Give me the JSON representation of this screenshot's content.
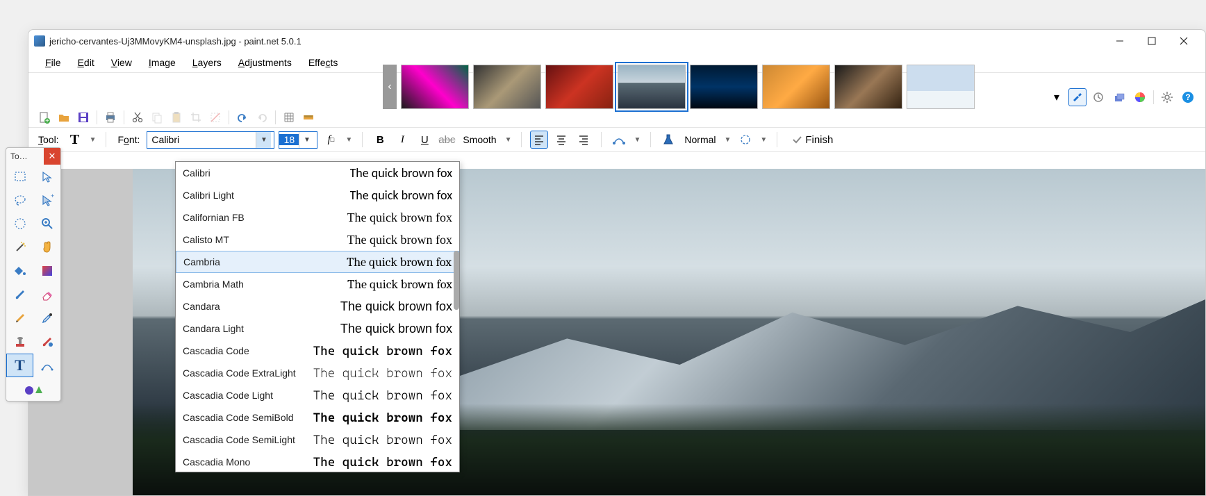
{
  "window": {
    "title": "jericho-cervantes-Uj3MMovyKM4-unsplash.jpg - paint.net 5.0.1"
  },
  "menu": {
    "file": "File",
    "edit": "Edit",
    "view": "View",
    "image": "Image",
    "layers": "Layers",
    "adjustments": "Adjustments",
    "effects": "Effects"
  },
  "toolbar_opts": {
    "tool_label": "Tool:",
    "font_label": "Font:",
    "font_value": "Calibri",
    "size_value": "18",
    "aa_label": "Smooth",
    "blend_label": "Normal",
    "finish_label": "Finish"
  },
  "toolbox": {
    "title": "To…"
  },
  "font_dropdown": {
    "sample": "The quick brown fox",
    "highlighted_index": 4,
    "items": [
      {
        "name": "Calibri",
        "style": "font-family: Calibri, sans-serif;"
      },
      {
        "name": "Calibri Light",
        "style": "font-family: 'Calibri Light', Calibri, sans-serif; font-weight: 300;"
      },
      {
        "name": "Californian FB",
        "style": "font-family: 'Californian FB', serif;"
      },
      {
        "name": "Calisto MT",
        "style": "font-family: 'Calisto MT', serif;"
      },
      {
        "name": "Cambria",
        "style": "font-family: Cambria, serif;"
      },
      {
        "name": "Cambria Math",
        "style": "font-family: 'Cambria Math', Cambria, serif;"
      },
      {
        "name": "Candara",
        "style": "font-family: Candara, sans-serif;"
      },
      {
        "name": "Candara Light",
        "style": "font-family: 'Candara Light', Candara, sans-serif; font-weight: 300;"
      },
      {
        "name": "Cascadia Code",
        "style": "font-family: 'Cascadia Code', Consolas, monospace;"
      },
      {
        "name": "Cascadia Code ExtraLight",
        "style": "font-family: 'Cascadia Code', Consolas, monospace; font-weight: 200;"
      },
      {
        "name": "Cascadia Code Light",
        "style": "font-family: 'Cascadia Code', Consolas, monospace; font-weight: 300;"
      },
      {
        "name": "Cascadia Code SemiBold",
        "style": "font-family: 'Cascadia Code', Consolas, monospace; font-weight: 600;"
      },
      {
        "name": "Cascadia Code SemiLight",
        "style": "font-family: 'Cascadia Code', Consolas, monospace; font-weight: 350;"
      },
      {
        "name": "Cascadia Mono",
        "style": "font-family: 'Cascadia Mono', Consolas, monospace;"
      }
    ]
  }
}
